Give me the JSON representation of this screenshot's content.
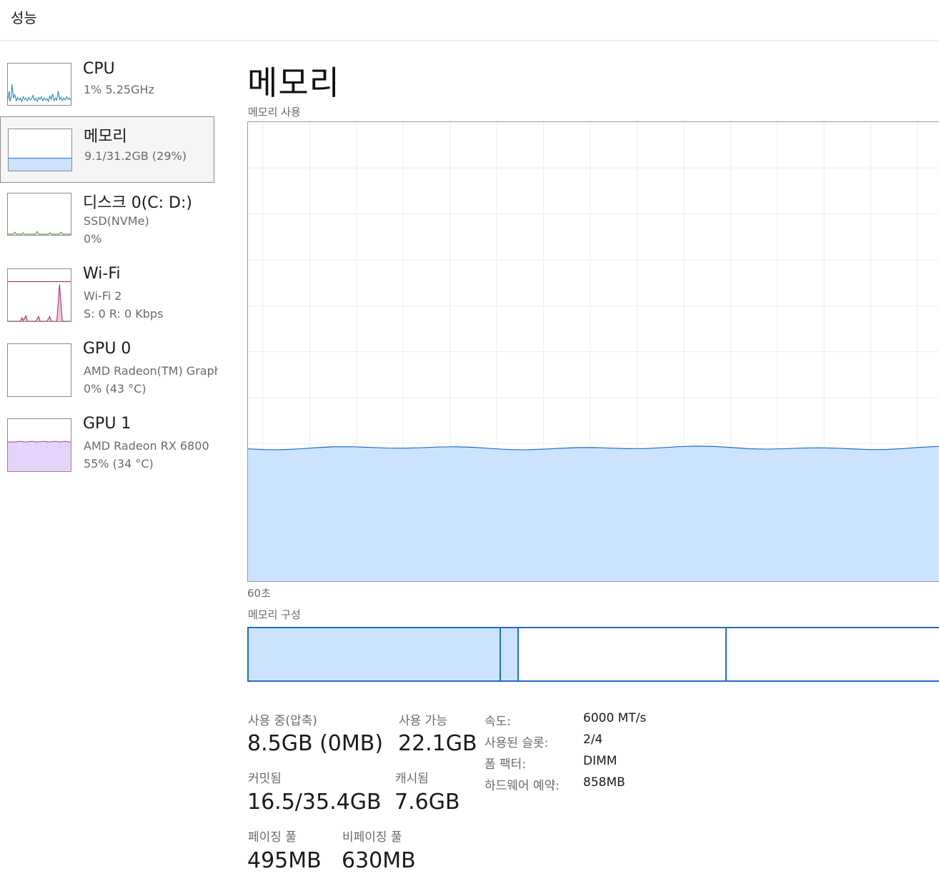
{
  "header": {
    "title": "성능"
  },
  "sidebar": {
    "items": [
      {
        "title": "CPU",
        "line1": "1%  5.25GHz",
        "line2": ""
      },
      {
        "title": "메모리",
        "line1": "9.1/31.2GB (29%)",
        "line2": ""
      },
      {
        "title": "디스크 0(C: D:)",
        "line1": "SSD(NVMe)",
        "line2": "0%"
      },
      {
        "title": "Wi-Fi",
        "line1": "Wi-Fi 2",
        "line2": "S: 0  R: 0 Kbps"
      },
      {
        "title": "GPU 0",
        "line1": "AMD Radeon(TM) Graphics",
        "line2": "0%  (43 °C)"
      },
      {
        "title": "GPU 1",
        "line1": "AMD Radeon RX 6800",
        "line2": "55%  (34 °C)"
      }
    ]
  },
  "main": {
    "title": "메모리",
    "usage_caption": "메모리 사용",
    "time_caption": "60초",
    "composition_caption": "메모리 구성",
    "usage_fraction": 0.29,
    "stats": {
      "in_use_label": "사용 중(압축)",
      "in_use_value": "8.5GB (0MB)",
      "available_label": "사용 가능",
      "available_value": "22.1GB",
      "committed_label": "커밋됨",
      "committed_value": "16.5/35.4GB",
      "cached_label": "캐시됨",
      "cached_value": "7.6GB",
      "paged_label": "페이징 풀",
      "paged_value": "495MB",
      "nonpaged_label": "비페이징 풀",
      "nonpaged_value": "630MB"
    },
    "details": [
      {
        "key": "속도:",
        "value": "6000 MT/s"
      },
      {
        "key": "사용된 슬롯:",
        "value": "2/4"
      },
      {
        "key": "폼 팩터:",
        "value": "DIMM"
      },
      {
        "key": "하드웨어 예약:",
        "value": "858MB"
      }
    ]
  },
  "colors": {
    "memory_line": "#1e6ec8",
    "memory_fill": "#cce3ff",
    "cpu_line": "#1b7fa8",
    "disk_line": "#4a8c2a",
    "wifi_line": "#a3205b",
    "gpu_line": "#8d4bbb",
    "gpu_fill": "#e6d3fa",
    "grid": "#ededed"
  }
}
